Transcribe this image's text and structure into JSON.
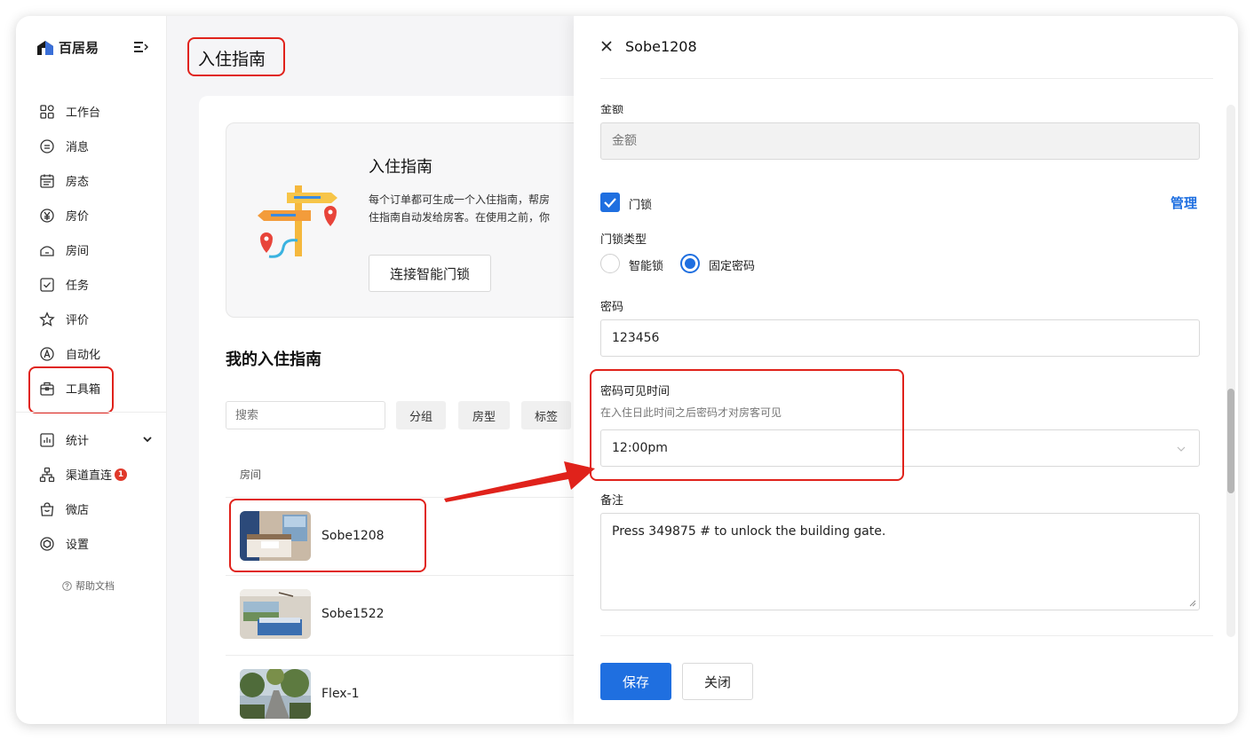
{
  "brand": {
    "name": "百居易"
  },
  "sidebar": {
    "items": [
      {
        "label": "工作台",
        "icon": "dashboard-icon"
      },
      {
        "label": "消息",
        "icon": "message-icon"
      },
      {
        "label": "房态",
        "icon": "calendar-icon"
      },
      {
        "label": "房价",
        "icon": "yen-icon"
      },
      {
        "label": "房间",
        "icon": "house-icon"
      },
      {
        "label": "任务",
        "icon": "checkbox-icon"
      },
      {
        "label": "评价",
        "icon": "star-icon"
      },
      {
        "label": "自动化",
        "icon": "automation-icon"
      },
      {
        "label": "工具箱",
        "icon": "toolbox-icon"
      }
    ],
    "items2": [
      {
        "label": "统计",
        "icon": "chart-icon"
      },
      {
        "label": "渠道直连",
        "icon": "channel-icon",
        "badge": "1"
      },
      {
        "label": "微店",
        "icon": "shop-bag-icon"
      },
      {
        "label": "设置",
        "icon": "settings-icon"
      }
    ],
    "help": "帮助文档"
  },
  "main": {
    "page_title": "入住指南",
    "intro": {
      "title": "入住指南",
      "desc": "每个订单都可生成一个入住指南，帮房\n住指南自动发给房客。在使用之前，你",
      "button": "连接智能门锁"
    },
    "section_title": "我的入住指南",
    "search_placeholder": "搜索",
    "filters": [
      "分组",
      "房型",
      "标签"
    ],
    "table": {
      "col_room": "房间",
      "rows": [
        {
          "name": "Sobe1208"
        },
        {
          "name": "Sobe1522"
        },
        {
          "name": "Flex-1"
        }
      ]
    }
  },
  "drawer": {
    "title": "Sobe1208",
    "amount_label": "金额",
    "amount_placeholder": "金额",
    "doorlock_label": "门锁",
    "doorlock_checked": true,
    "manage": "管理",
    "lock_type_label": "门锁类型",
    "lock_types": [
      {
        "label": "智能锁",
        "checked": false
      },
      {
        "label": "固定密码",
        "checked": true
      }
    ],
    "password_label": "密码",
    "password_value": "123456",
    "visible_time_label": "密码可见时间",
    "visible_time_hint": "在入住日此时间之后密码才对房客可见",
    "visible_time_value": "12:00pm",
    "note_label": "备注",
    "note_value": "Press 349875 # to unlock the building gate.",
    "save": "保存",
    "close": "关闭"
  },
  "colors": {
    "accent": "#1f6fe0",
    "annotation": "#e0221b",
    "badge": "#e0392b"
  }
}
